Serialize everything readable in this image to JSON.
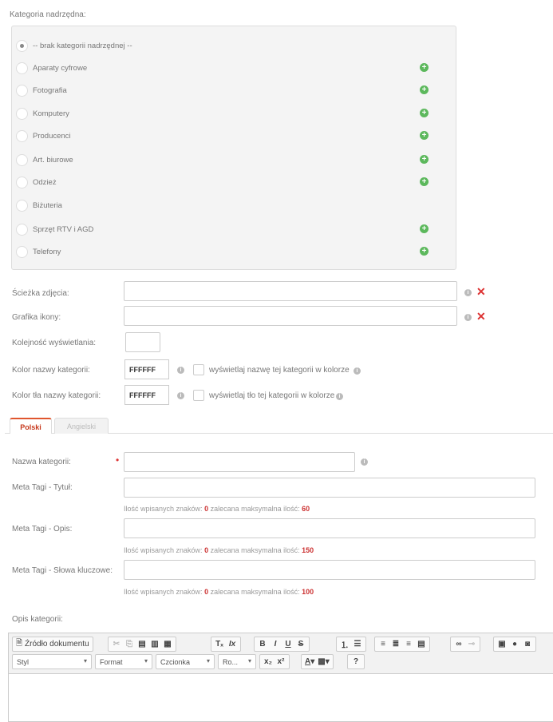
{
  "parent": {
    "title": "Kategoria nadrzędna:",
    "options": [
      {
        "label": "-- brak kategorii nadrzędnej --",
        "checked": true,
        "addable": false
      },
      {
        "label": "Aparaty cyfrowe",
        "checked": false,
        "addable": true
      },
      {
        "label": "Fotografia",
        "checked": false,
        "addable": true
      },
      {
        "label": "Komputery",
        "checked": false,
        "addable": true
      },
      {
        "label": "Producenci",
        "checked": false,
        "addable": true
      },
      {
        "label": "Art. biurowe",
        "checked": false,
        "addable": true
      },
      {
        "label": "Odzież",
        "checked": false,
        "addable": true
      },
      {
        "label": "Biżuteria",
        "checked": false,
        "addable": false
      },
      {
        "label": "Sprzęt RTV i AGD",
        "checked": false,
        "addable": true
      },
      {
        "label": "Telefony",
        "checked": false,
        "addable": true
      }
    ]
  },
  "fields": {
    "image_path_label": "Ścieżka zdjęcia:",
    "icon_label": "Grafika ikony:",
    "order_label": "Kolejność wyświetlania:",
    "name_color_label": "Kolor nazwy kategorii:",
    "name_color_value": "FFFFFF",
    "name_color_checkbox": "wyświetlaj nazwę tej kategorii w kolorze",
    "bg_color_label": "Kolor tła nazwy kategorii:",
    "bg_color_value": "FFFFFF",
    "bg_color_checkbox": "wyświetlaj tło tej kategorii w kolorze"
  },
  "tabs": [
    {
      "label": "Polski",
      "active": true
    },
    {
      "label": "Angielski",
      "active": false
    }
  ],
  "lang": {
    "name_label": "Nazwa kategorii:",
    "meta_title_label": "Meta Tagi - Tytuł:",
    "meta_desc_label": "Meta Tagi - Opis:",
    "meta_keys_label": "Meta Tagi - Słowa kluczowe:",
    "hint_prefix": "Ilość wpisanych znaków:",
    "hint_middle": "zalecana maksymalna ilość:",
    "title_count": "0",
    "title_max": "60",
    "desc_count": "0",
    "desc_max": "150",
    "keys_count": "0",
    "keys_max": "100",
    "description_label": "Opis kategorii:"
  },
  "editor": {
    "source_label": "Źródło dokumentu",
    "style_combo": "Styl",
    "format_combo": "Format",
    "font_combo": "Czcionka",
    "size_combo": "Ro...",
    "help": "?"
  }
}
